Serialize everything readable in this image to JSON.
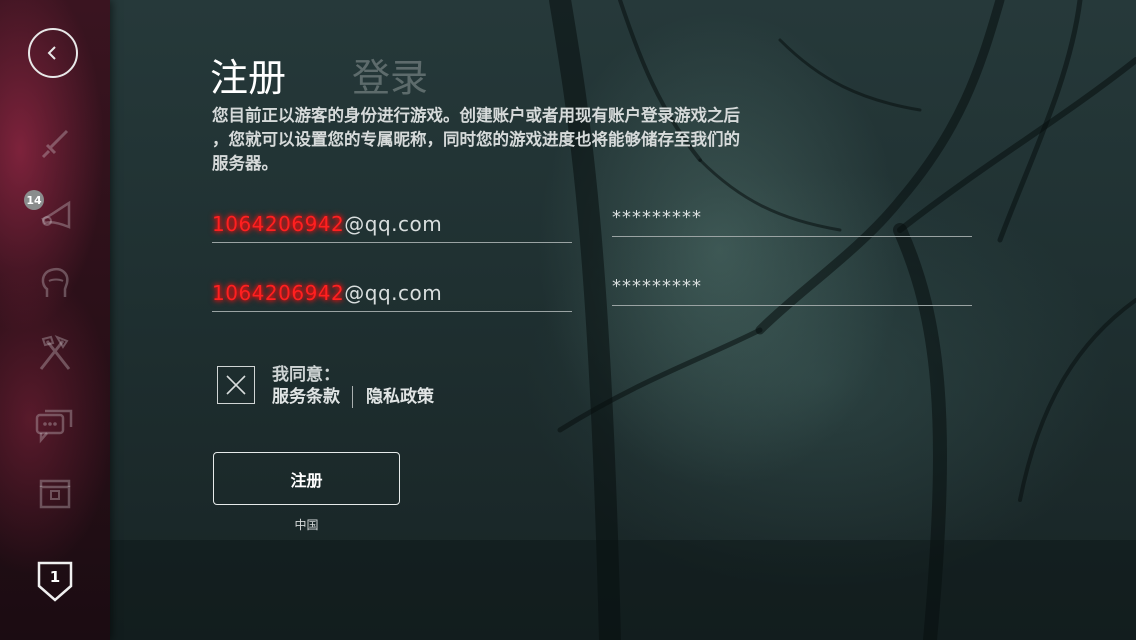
{
  "tabs": {
    "register": "注册",
    "login": "登录",
    "active": "register"
  },
  "intro": {
    "line1": "您目前正以游客的身份进行游戏。创建账户或者用现有账户登录游戏之后",
    "line2": "，您就可以设置您的专属昵称，同时您的游戏进度也将能够储存至我们的",
    "line3": "服务器。"
  },
  "form": {
    "email": {
      "redacted": "1064206942",
      "suffix": "@qq.com"
    },
    "email_confirm": {
      "redacted": "1064206942",
      "suffix": "@qq.com"
    },
    "password": "*********",
    "password_confirm": "*********"
  },
  "agreement": {
    "checked": false,
    "label": "我同意：",
    "terms": "服务条款",
    "privacy": "隐私政策"
  },
  "submit_label": "注册",
  "region": "中国",
  "sidebar": {
    "notification_count": "14",
    "level": "1",
    "icons": [
      "back-icon",
      "sword-icon",
      "horn-icon",
      "head-icon",
      "axe-hammer-icon",
      "chat-icon",
      "chest-icon",
      "level-badge-icon"
    ]
  },
  "colors": {
    "redaction": "#ff2020",
    "sidebar": "#2c1019",
    "background": "#1f3031"
  }
}
